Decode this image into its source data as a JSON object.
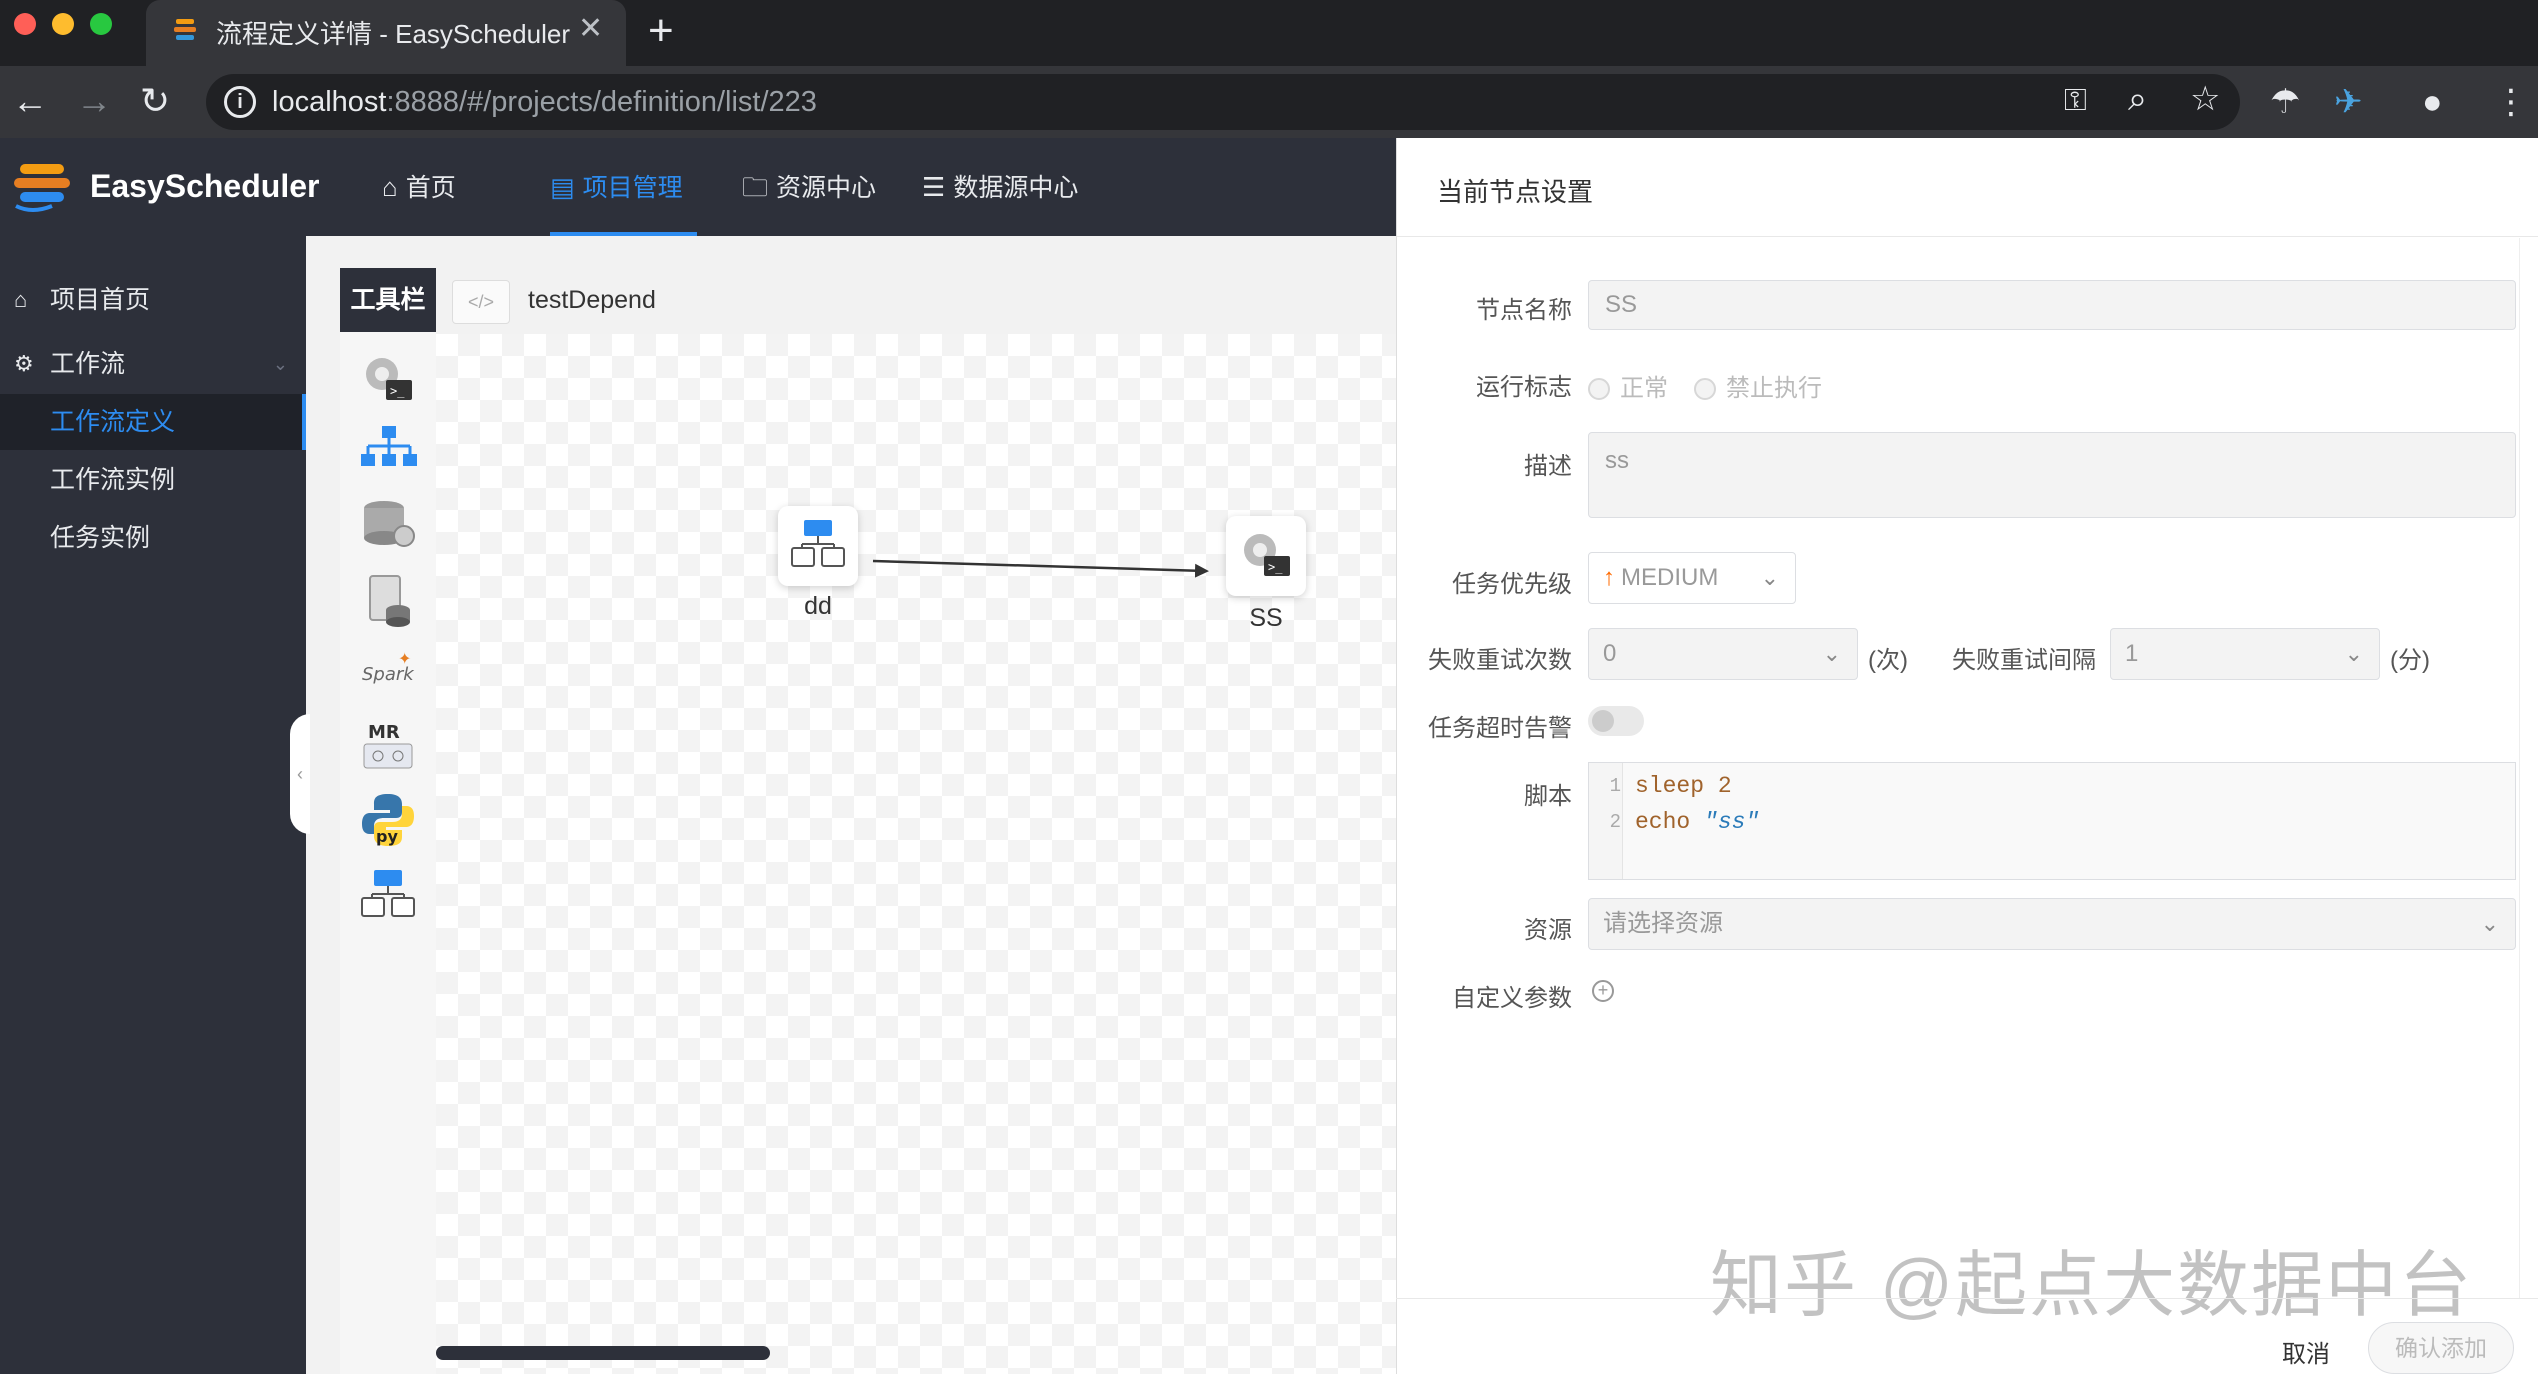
{
  "browser": {
    "tab_title": "流程定义详情 - EasyScheduler",
    "url_host": "localhost",
    "url_rest": ":8888/#/projects/definition/list/223"
  },
  "app": {
    "logo_text": "EasyScheduler",
    "menu": [
      {
        "label": "首页",
        "icon": "home-icon"
      },
      {
        "label": "项目管理",
        "icon": "project-icon",
        "active": true
      },
      {
        "label": "资源中心",
        "icon": "folder-icon"
      },
      {
        "label": "数据源中心",
        "icon": "database-icon"
      }
    ]
  },
  "sidebar": {
    "items": [
      {
        "label": "项目首页",
        "icon": "home-icon"
      },
      {
        "label": "工作流",
        "icon": "gear-icon"
      },
      {
        "label": "工作流定义",
        "active": true
      },
      {
        "label": "工作流实例"
      },
      {
        "label": "任务实例"
      }
    ]
  },
  "canvas": {
    "tools_label": "工具栏",
    "process_name": "testDepend",
    "tools": [
      "shell-tool-icon",
      "sub-process-tool-icon",
      "procedure-tool-icon",
      "sql-tool-icon",
      "spark-tool-icon",
      "mr-tool-icon",
      "python-tool-icon",
      "dependent-tool-icon"
    ],
    "nodes": [
      {
        "label": "dd",
        "type": "dependent"
      },
      {
        "label": "SS",
        "type": "shell"
      }
    ],
    "edges": [
      {
        "from": "dd",
        "to": "SS"
      }
    ]
  },
  "drawer": {
    "title": "当前节点设置",
    "node_name_label": "节点名称",
    "node_name_value": "SS",
    "run_flag_label": "运行标志",
    "run_flag_options": [
      "正常",
      "禁止执行"
    ],
    "desc_label": "描述",
    "desc_value": "ss",
    "priority_label": "任务优先级",
    "priority_value": "MEDIUM",
    "retry_times_label": "失败重试次数",
    "retry_times_value": "0",
    "retry_times_unit": "(次)",
    "retry_interval_label": "失败重试间隔",
    "retry_interval_value": "1",
    "retry_interval_unit": "(分)",
    "timeout_label": "任务超时告警",
    "timeout_enabled": false,
    "script_label": "脚本",
    "script_lines": [
      {
        "no": "1",
        "cmd": "sleep",
        "arg": "2"
      },
      {
        "no": "2",
        "cmd": "echo",
        "arg": "\"ss\""
      }
    ],
    "resource_label": "资源",
    "resource_placeholder": "请选择资源",
    "custom_params_label": "自定义参数",
    "cancel_label": "取消",
    "confirm_label": "确认添加"
  },
  "watermark": "知乎 @起点大数据中台",
  "colors": {
    "accent": "#2d8cf0",
    "header_bg": "#2d303a",
    "priority_arrow": "#ff6a00"
  }
}
